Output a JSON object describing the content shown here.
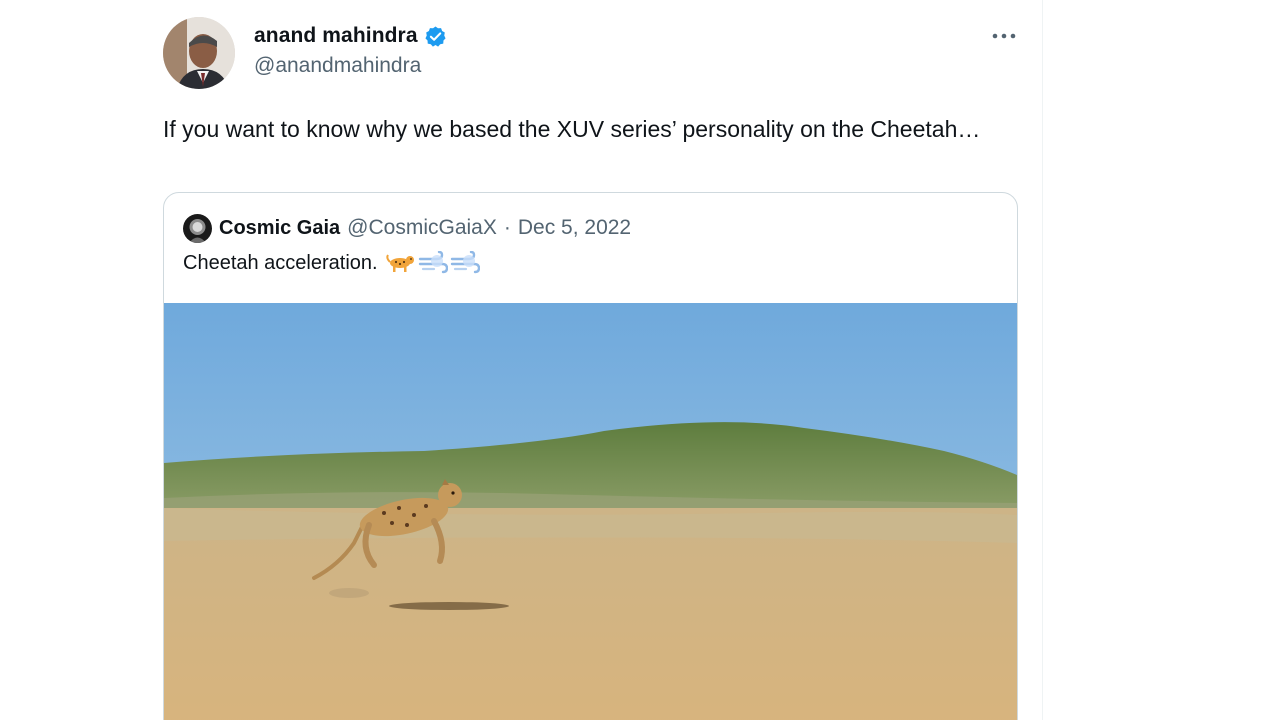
{
  "tweet": {
    "author_name": "anand mahindra",
    "author_handle": "@anandmahindra",
    "text": "If you want to know why we based the XUV series’ personality on the Cheetah…",
    "more_label": "···",
    "verified_color": "#1d9bf0"
  },
  "quote": {
    "author_name": "Cosmic Gaia",
    "author_handle": "@CosmicGaiaX",
    "separator": "·",
    "date": "Dec 5, 2022",
    "text": "Cheetah acceleration.",
    "emojis": [
      "leopard-icon",
      "dash-icon",
      "dash-icon"
    ]
  },
  "colors": {
    "text_primary": "#0f1419",
    "text_secondary": "#536471",
    "border": "#cfd9de",
    "sky": "#7fb6df",
    "sand": "#d8b57c"
  }
}
